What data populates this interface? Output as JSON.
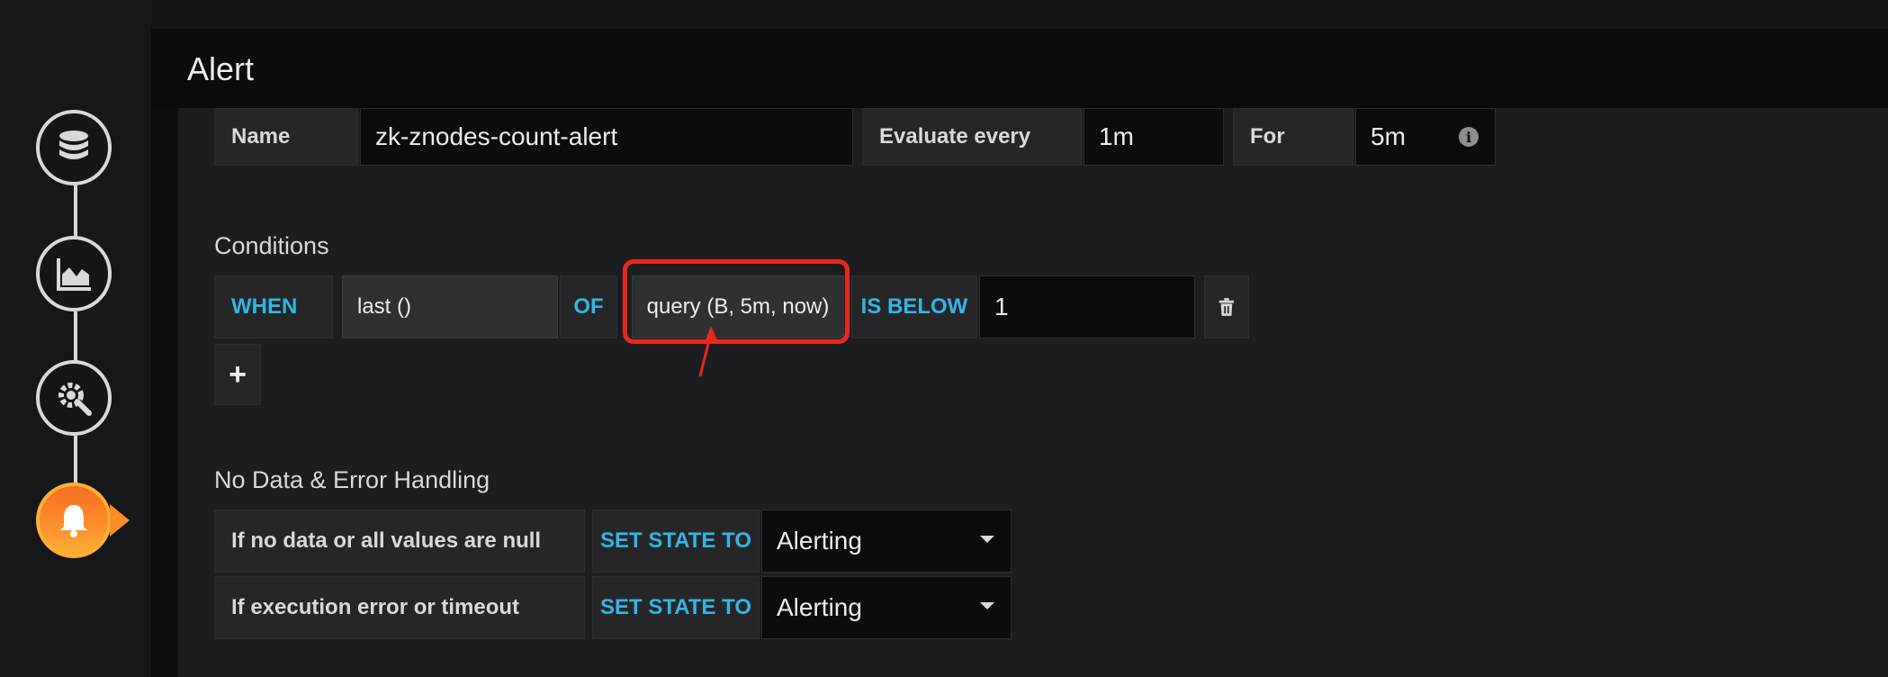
{
  "panel": {
    "title": "Alert"
  },
  "sidebar": {
    "steps": [
      {
        "name": "queries",
        "icon": "database-icon"
      },
      {
        "name": "visualization",
        "icon": "area-chart-icon"
      },
      {
        "name": "general",
        "icon": "gear-wrench-icon"
      },
      {
        "name": "alert",
        "icon": "bell-icon",
        "active": true
      }
    ]
  },
  "settings": {
    "name_label": "Name",
    "name_value": "zk-znodes-count-alert",
    "evaluate_label": "Evaluate every",
    "evaluate_value": "1m",
    "for_label": "For",
    "for_value": "5m"
  },
  "conditions": {
    "title": "Conditions",
    "when": "WHEN",
    "reducer": "last ()",
    "of": "OF",
    "query": "query (B, 5m, now)",
    "evaluator": "IS BELOW",
    "threshold": "1",
    "add_label": "+"
  },
  "no_data": {
    "title": "No Data & Error Handling",
    "rows": [
      {
        "label": "If no data or all values are null",
        "keyword": "SET STATE TO",
        "value": "Alerting"
      },
      {
        "label": "If execution error or timeout",
        "keyword": "SET STATE TO",
        "value": "Alerting"
      }
    ]
  },
  "colors": {
    "accent": "#33b5e5",
    "highlight": "#e8281e",
    "alert_active": "#fb8c2a"
  }
}
